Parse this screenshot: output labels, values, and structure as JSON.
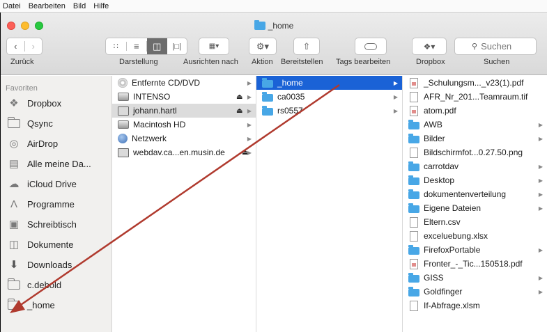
{
  "menubar": {
    "items": [
      "Datei",
      "Bearbeiten",
      "Bild",
      "Hilfe"
    ]
  },
  "window": {
    "title": "_home"
  },
  "toolbar": {
    "search_placeholder": "Suchen",
    "labels": {
      "back": "Zurück",
      "view": "Darstellung",
      "arrange": "Ausrichten nach",
      "action": "Aktion",
      "share": "Bereitstellen",
      "tags": "Tags bearbeiten",
      "dropbox": "Dropbox",
      "search": "Suchen"
    }
  },
  "sidebar": {
    "heading": "Favoriten",
    "items": [
      {
        "label": "Dropbox",
        "icon": "dropbox-icon"
      },
      {
        "label": "Qsync",
        "icon": "folder-icon"
      },
      {
        "label": "AirDrop",
        "icon": "airdrop-icon"
      },
      {
        "label": "Alle meine Da...",
        "icon": "all-files-icon"
      },
      {
        "label": "iCloud Drive",
        "icon": "cloud-icon"
      },
      {
        "label": "Programme",
        "icon": "applications-icon"
      },
      {
        "label": "Schreibtisch",
        "icon": "desktop-icon"
      },
      {
        "label": "Dokumente",
        "icon": "documents-icon"
      },
      {
        "label": "Downloads",
        "icon": "downloads-icon"
      },
      {
        "label": "c.debold",
        "icon": "folder-icon"
      },
      {
        "label": "_home",
        "icon": "folder-icon"
      }
    ]
  },
  "column1": {
    "items": [
      {
        "label": "Entfernte CD/DVD",
        "icon": "cd-icon",
        "eject": false,
        "selected": false
      },
      {
        "label": "INTENSO",
        "icon": "drive-icon",
        "eject": true,
        "selected": false
      },
      {
        "label": "johann.hartl",
        "icon": "network-drive-icon",
        "eject": true,
        "selected": true
      },
      {
        "label": "Macintosh HD",
        "icon": "harddisk-icon",
        "eject": false,
        "selected": false
      },
      {
        "label": "Netzwerk",
        "icon": "network-icon",
        "eject": false,
        "selected": false
      },
      {
        "label": "webdav.ca...en.musin.de",
        "icon": "network-drive-icon",
        "eject": true,
        "selected": false
      }
    ]
  },
  "column2": {
    "items": [
      {
        "label": "_home",
        "selected": true
      },
      {
        "label": "ca0035",
        "selected": false
      },
      {
        "label": "rs0557",
        "selected": false
      }
    ]
  },
  "column3": {
    "items": [
      {
        "label": "_Schulungsm..._v23(1).pdf",
        "type": "file",
        "folder": false
      },
      {
        "label": "AFR_Nr_201...Teamraum.tif",
        "type": "file",
        "folder": false
      },
      {
        "label": "atom.pdf",
        "type": "file",
        "folder": false
      },
      {
        "label": "AWB",
        "type": "folder",
        "folder": true
      },
      {
        "label": "Bilder",
        "type": "folder",
        "folder": true
      },
      {
        "label": "Bildschirmfot...0.27.50.png",
        "type": "file",
        "folder": false
      },
      {
        "label": "carrotdav",
        "type": "folder",
        "folder": true
      },
      {
        "label": "Desktop",
        "type": "folder",
        "folder": true
      },
      {
        "label": "dokumentenverteilung",
        "type": "folder",
        "folder": true
      },
      {
        "label": "Eigene Dateien",
        "type": "folder",
        "folder": true
      },
      {
        "label": "Eltern.csv",
        "type": "file",
        "folder": false
      },
      {
        "label": "exceluebung.xlsx",
        "type": "file",
        "folder": false
      },
      {
        "label": "FirefoxPortable",
        "type": "folder",
        "folder": true
      },
      {
        "label": "Fronter_-_Tic...150518.pdf",
        "type": "file",
        "folder": false
      },
      {
        "label": "GISS",
        "type": "folder",
        "folder": true
      },
      {
        "label": "Goldfinger",
        "type": "folder",
        "folder": true
      },
      {
        "label": "If-Abfrage.xlsm",
        "type": "file",
        "folder": false
      }
    ]
  },
  "colors": {
    "selection": "#1a62d6",
    "folder": "#48a7e6",
    "annotation_arrow": "#b03a2e"
  }
}
